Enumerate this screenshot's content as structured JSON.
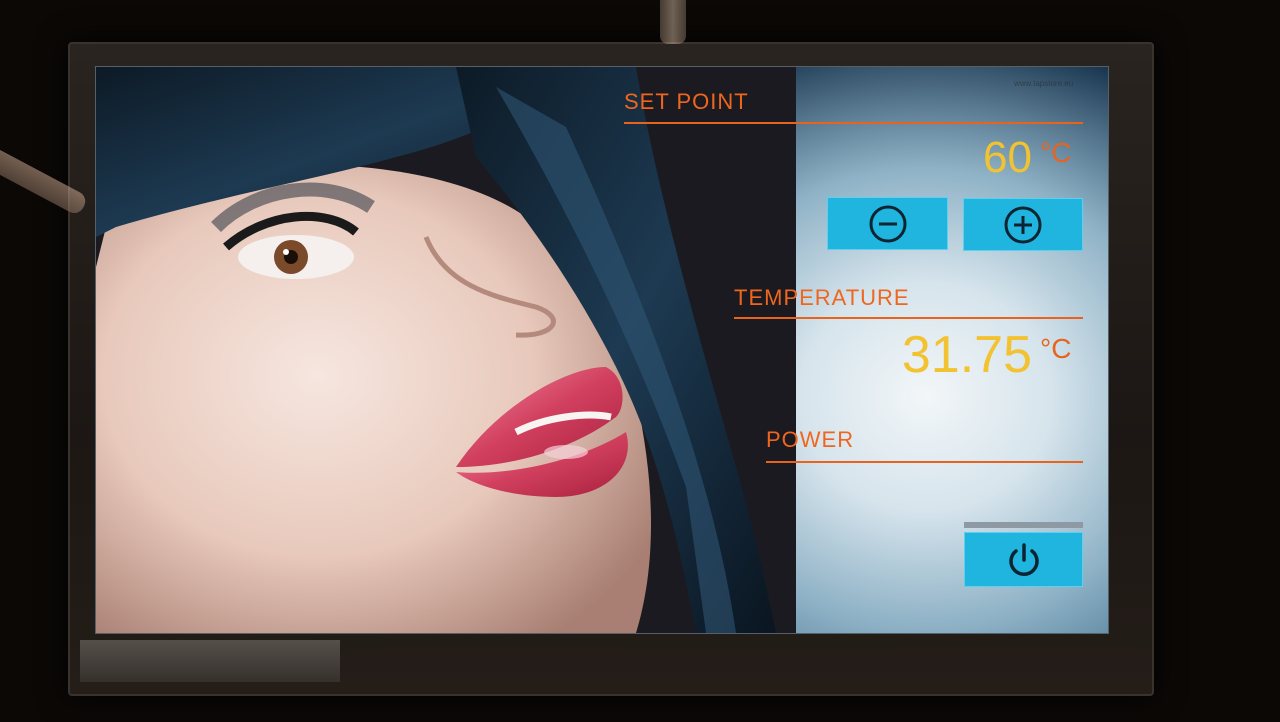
{
  "setpoint": {
    "label": "SET POINT",
    "value": "60",
    "unit": "°C"
  },
  "temperature": {
    "label": "TEMPERATURE",
    "value": "31.75",
    "unit": "°C"
  },
  "power": {
    "label": "POWER"
  },
  "icons": {
    "decrease": "minus-circle-icon",
    "increase": "plus-circle-icon",
    "power": "power-icon"
  },
  "colors": {
    "accent_orange": "#f0661e",
    "value_yellow": "#f2c230",
    "button_cyan": "#1fb5df"
  }
}
